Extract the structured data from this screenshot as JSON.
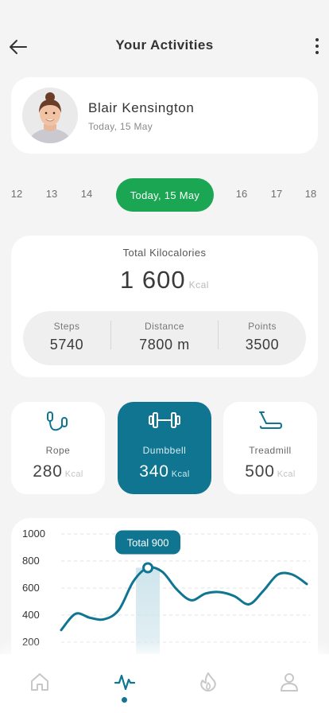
{
  "header": {
    "title": "Your Activities"
  },
  "profile": {
    "name": "Blair Kensington",
    "date": "Today, 15 May"
  },
  "dates": {
    "before": [
      "12",
      "13",
      "14"
    ],
    "active": "Today, 15 May",
    "after": [
      "16",
      "17",
      "18"
    ]
  },
  "kcal": {
    "label": "Total Kilocalories",
    "value": "1 600",
    "unit": "Kcal",
    "stats": [
      {
        "label": "Steps",
        "value": "5740"
      },
      {
        "label": "Distance",
        "value": "7800 m"
      },
      {
        "label": "Points",
        "value": "3500"
      }
    ]
  },
  "activities": [
    {
      "name": "Rope",
      "value": "280",
      "unit": "Kcal",
      "icon": "jump-rope-icon",
      "active": false
    },
    {
      "name": "Dumbbell",
      "value": "340",
      "unit": "Kcal",
      "icon": "dumbbell-icon",
      "active": true
    },
    {
      "name": "Treadmill",
      "value": "500",
      "unit": "Kcal",
      "icon": "treadmill-icon",
      "active": false
    }
  ],
  "chart_data": {
    "type": "line",
    "tooltip": "Total 900",
    "y_ticks": [
      "1000",
      "800",
      "600",
      "400",
      "200"
    ],
    "ylim": [
      0,
      1000
    ],
    "grid": true,
    "series": [
      {
        "values": [
          290,
          410,
          380,
          370,
          440,
          650,
          750,
          720,
          590,
          510,
          560,
          570,
          540,
          480,
          580,
          700,
          700,
          630
        ]
      }
    ],
    "highlight_index": 6,
    "color": "#0f7591"
  },
  "nav": {
    "items": [
      "home-icon",
      "activity-icon",
      "flame-icon",
      "profile-icon"
    ],
    "active_index": 1
  },
  "colors": {
    "accent": "#0f7591",
    "green": "#1aa652",
    "background": "#f4f4f4"
  }
}
